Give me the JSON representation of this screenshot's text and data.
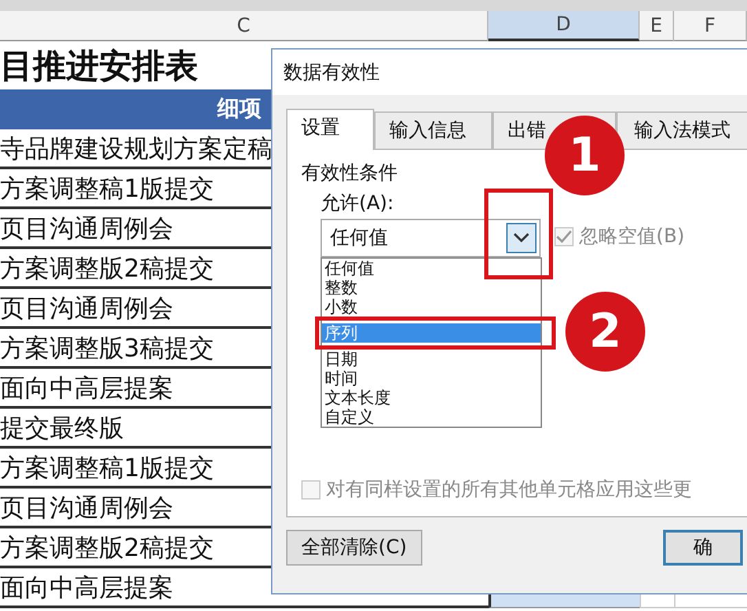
{
  "sheet": {
    "columns": [
      {
        "label": "C",
        "selected": false
      },
      {
        "label": "D",
        "selected": true
      },
      {
        "label": "E",
        "selected": false
      },
      {
        "label": "F",
        "selected": false
      }
    ],
    "title": "目推进安排表",
    "header": "细项",
    "rows": [
      "寺品牌建设规划方案定稿",
      "方案调整稿1版提交",
      "页目沟通周例会",
      "方案调整版2稿提交",
      "页目沟通周例会",
      "方案调整版3稿提交",
      "面向中高层提案",
      "提交最终版",
      "方案调整稿1版提交",
      "页目沟通周例会",
      "方案调整版2稿提交",
      "面向中高层提案"
    ]
  },
  "dialog": {
    "title": "数据有效性",
    "tabs": [
      {
        "label": "设置",
        "selected": true
      },
      {
        "label": "输入信息",
        "selected": false
      },
      {
        "label": "出错",
        "selected": false
      },
      {
        "label": "输入法模式",
        "selected": false
      }
    ],
    "section": "有效性条件",
    "allow_label": "允许(A):",
    "allow_value": "任何值",
    "options": [
      {
        "label": "任何值",
        "selected": false
      },
      {
        "label": "整数",
        "selected": false
      },
      {
        "label": "小数",
        "selected": false
      },
      {
        "label": "序列",
        "selected": true
      },
      {
        "label": "日期",
        "selected": false
      },
      {
        "label": "时间",
        "selected": false
      },
      {
        "label": "文本长度",
        "selected": false
      },
      {
        "label": "自定义",
        "selected": false
      }
    ],
    "ignore_blank": {
      "label": "忽略空值(B)",
      "checked": true,
      "disabled": true
    },
    "apply_all": {
      "label": "对有同样设置的所有其他单元格应用这些更",
      "checked": false,
      "disabled": true
    },
    "buttons": [
      "全部清除(C)",
      "确"
    ]
  },
  "callouts": [
    "1",
    "2"
  ]
}
